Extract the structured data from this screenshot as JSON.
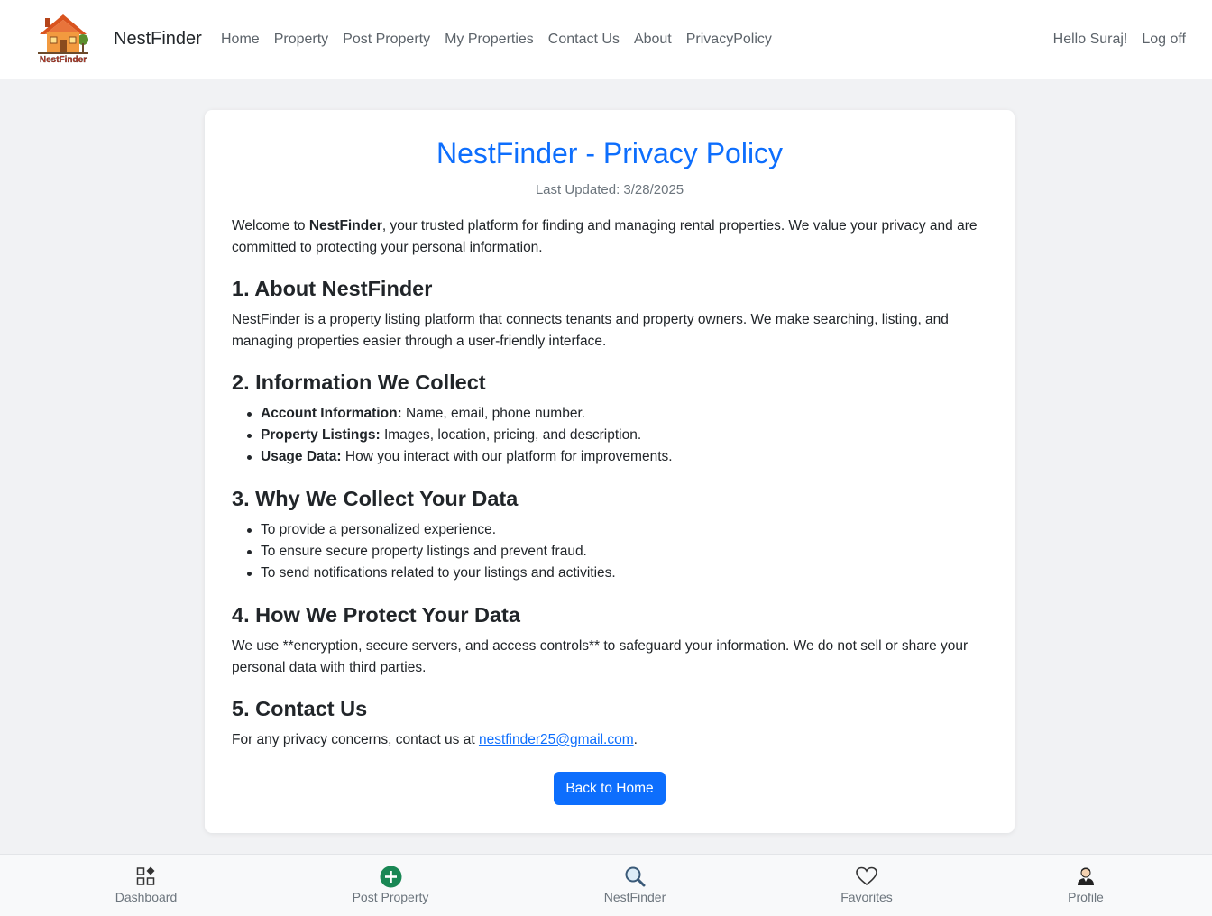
{
  "brand": {
    "name": "NestFinder",
    "logo_text": "NestFinder"
  },
  "nav": {
    "links": [
      "Home",
      "Property",
      "Post Property",
      "My Properties",
      "Contact Us",
      "About",
      "PrivacyPolicy"
    ],
    "greeting": "Hello Suraj!",
    "logoff": "Log off"
  },
  "page": {
    "title": "NestFinder - Privacy Policy",
    "last_updated": "Last Updated: 3/28/2025",
    "intro_prefix": "Welcome to ",
    "intro_bold": "NestFinder",
    "intro_suffix": ", your trusted platform for finding and managing rental properties. We value your privacy and are committed to protecting your personal information.",
    "sections": {
      "about": {
        "heading": "1. About NestFinder",
        "text": "NestFinder is a property listing platform that connects tenants and property owners. We make searching, listing, and managing properties easier through a user-friendly interface."
      },
      "collect": {
        "heading": "2. Information We Collect",
        "items": [
          {
            "label": "Account Information:",
            "text": " Name, email, phone number."
          },
          {
            "label": "Property Listings:",
            "text": " Images, location, pricing, and description."
          },
          {
            "label": "Usage Data:",
            "text": " How you interact with our platform for improvements."
          }
        ]
      },
      "why": {
        "heading": "3. Why We Collect Your Data",
        "items": [
          "To provide a personalized experience.",
          "To ensure secure property listings and prevent fraud.",
          "To send notifications related to your listings and activities."
        ]
      },
      "protect": {
        "heading": "4. How We Protect Your Data",
        "text": "We use **encryption, secure servers, and access controls** to safeguard your information. We do not sell or share your personal data with third parties."
      },
      "contact": {
        "heading": "5. Contact Us",
        "text_prefix": "For any privacy concerns, contact us at ",
        "email": "nestfinder25@gmail.com",
        "text_suffix": "."
      }
    },
    "back_button": "Back to Home"
  },
  "bottom_nav": {
    "items": [
      {
        "label": "Dashboard",
        "icon": "dashboard-icon"
      },
      {
        "label": "Post Property",
        "icon": "plus-circle-icon"
      },
      {
        "label": "NestFinder",
        "icon": "search-icon"
      },
      {
        "label": "Favorites",
        "icon": "heart-icon"
      },
      {
        "label": "Profile",
        "icon": "user-icon"
      }
    ]
  },
  "colors": {
    "primary": "#0d6efd",
    "post_green": "#198754",
    "page_bg": "#f1f2f4"
  }
}
